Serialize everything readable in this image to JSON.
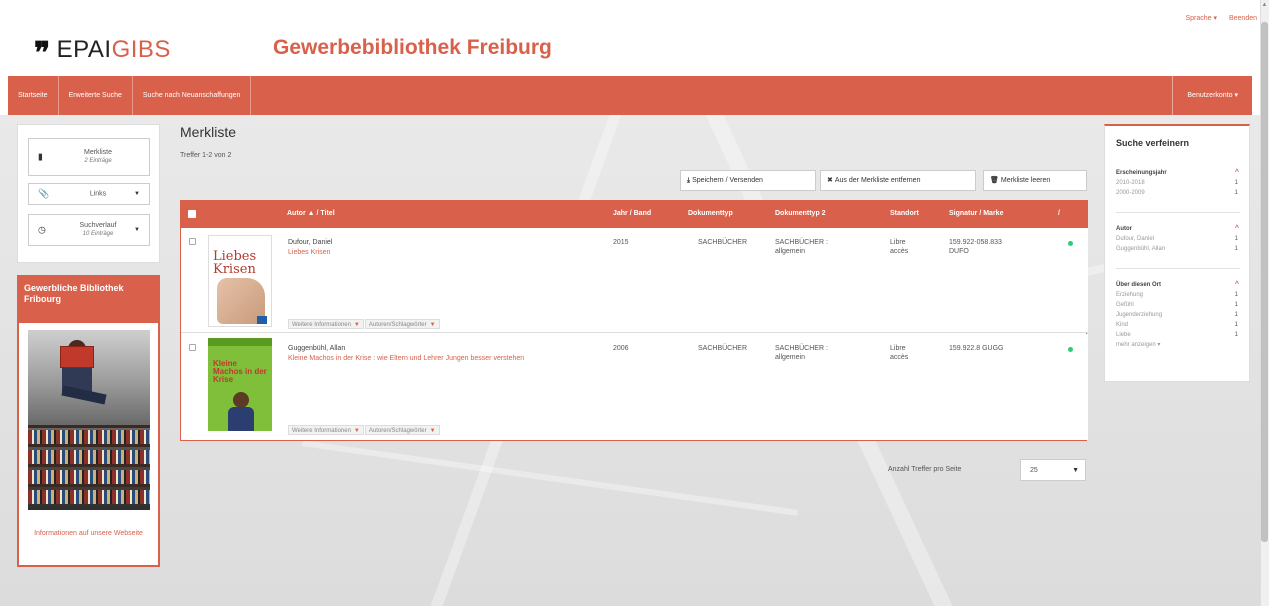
{
  "top_links": {
    "language": "Sprache ▾",
    "quit": "Beenden"
  },
  "logo": {
    "mark": "❞",
    "epai": "EPAI",
    "gibs": "GIBS"
  },
  "library_title": "Gewerbebibliothek Freiburg",
  "nav": {
    "items": [
      "Startseite",
      "Erweiterte Suche",
      "Suche nach Neuanschaffungen"
    ],
    "account": "Benutzerkonto ▾"
  },
  "left": {
    "merkliste": {
      "label": "Merkliste",
      "sub": "2 Einträge"
    },
    "links": {
      "label": "Links"
    },
    "history": {
      "label": "Suchverlauf",
      "sub": "10 Einträge"
    }
  },
  "promo": {
    "title": "Gewerbliche Bibliothek Fribourg",
    "link": "Informationen auf unsere Webseite"
  },
  "page": {
    "title": "Merkliste",
    "hits": "Treffer 1-2 von 2"
  },
  "actions": {
    "save": "Speichern / Versenden",
    "remove": "Aus der Merkliste entfernen",
    "clear": "Merkliste leeren"
  },
  "table": {
    "headers": {
      "author_title": "Autor ▲ / Titel",
      "year": "Jahr / Band",
      "doctype": "Dokumenttyp",
      "doctype2": "Dokumenttyp 2",
      "location": "Standort",
      "signature": "Signatur / Marke",
      "slash": "/"
    },
    "rows": [
      {
        "cover_text": "Liebes Krisen",
        "author": "Dufour, Daniel",
        "title": "Liebes Krisen",
        "year": "2015",
        "doctype": "SACHBÜCHER",
        "doctype2": "SACHBÜCHER : allgemein",
        "location": "Libre accès",
        "signature": "159.922-058.833 DUFO",
        "tag_more": "Weitere Informationen",
        "tag_authors": "Autoren/Schlagwörter"
      },
      {
        "cover_text": "Kleine Machos in der Krise",
        "author": "Guggenbühl, Allan",
        "title": "Kleine Machos in der Krise : wie Eltern und Lehrer Jungen besser verstehen",
        "year": "2006",
        "doctype": "SACHBÜCHER",
        "doctype2": "SACHBÜCHER : allgemein",
        "location": "Libre accès",
        "signature": "159.922.8 GUGG",
        "tag_more": "Weitere Informationen",
        "tag_authors": "Autoren/Schlagwörter"
      }
    ]
  },
  "pager": {
    "label": "Anzahl Treffer pro Seite",
    "value": "25"
  },
  "refine": {
    "title": "Suche verfeinern",
    "facets": [
      {
        "name": "Erscheinungsjahr",
        "items": [
          {
            "label": "2010-2018",
            "count": "1"
          },
          {
            "label": "2000-2009",
            "count": "1"
          }
        ]
      },
      {
        "name": "Autor",
        "items": [
          {
            "label": "Dufour, Daniel",
            "count": "1"
          },
          {
            "label": "Guggenbühl, Allan",
            "count": "1"
          }
        ]
      },
      {
        "name": "Über diesen Ort",
        "items": [
          {
            "label": "Erziehung",
            "count": "1"
          },
          {
            "label": "Gefühl",
            "count": "1"
          },
          {
            "label": "Jugenderziehung",
            "count": "1"
          },
          {
            "label": "Kind",
            "count": "1"
          },
          {
            "label": "Liebe",
            "count": "1"
          }
        ],
        "more": "mehr anzeigen ▾"
      }
    ]
  },
  "colors": {
    "accent": "#d9614b",
    "available": "#2ecc71"
  }
}
